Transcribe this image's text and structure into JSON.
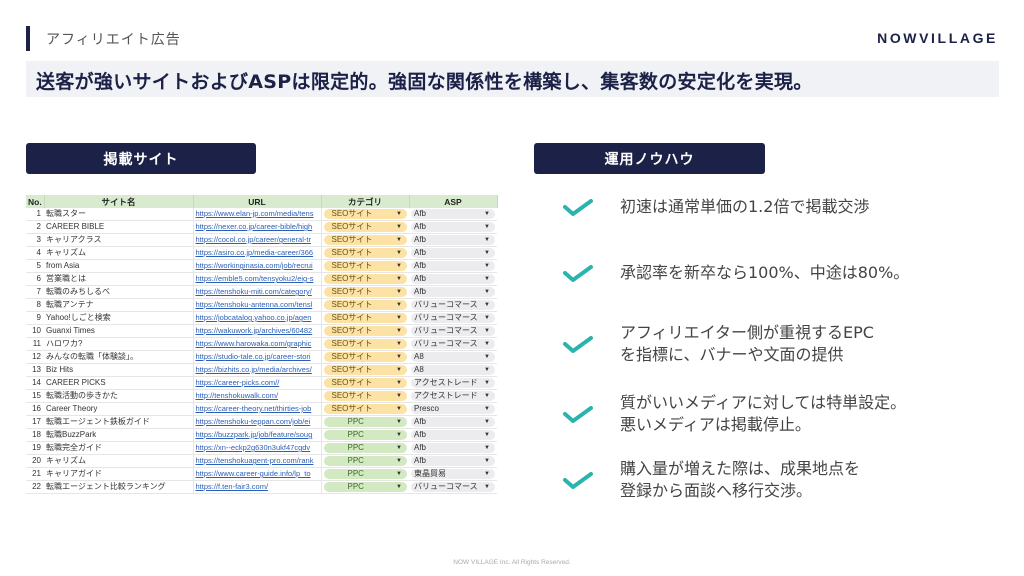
{
  "header": {
    "section_label": "アフィリエイト広告",
    "logo": "NOWVILLAGE",
    "headline": "送客が強いサイトおよびASPは限定的。強固な関係性を構築し、集客数の安定化を実現。"
  },
  "left_panel": {
    "title": "掲載サイト",
    "table": {
      "columns": [
        "No.",
        "サイト名",
        "URL",
        "カテゴリ",
        "ASP"
      ],
      "rows": [
        {
          "no": "1",
          "name": "転職スター",
          "url": "https://www.elan-jp.com/media/tens",
          "category": "SEOサイト",
          "asp": "Afb"
        },
        {
          "no": "2",
          "name": "CAREER BIBLE",
          "url": "https://nexer.co.jp/career-bible/high",
          "category": "SEOサイト",
          "asp": "Afb"
        },
        {
          "no": "3",
          "name": "キャリアクラス",
          "url": "https://cocol.co.jp/career/general-tr",
          "category": "SEOサイト",
          "asp": "Afb"
        },
        {
          "no": "4",
          "name": "キャリズム",
          "url": "https://asiro.co.jp/media-career/366",
          "category": "SEOサイト",
          "asp": "Afb"
        },
        {
          "no": "5",
          "name": "from Asia",
          "url": "https://workinginasia.com/job/recrui",
          "category": "SEOサイト",
          "asp": "Afb"
        },
        {
          "no": "6",
          "name": "営業職とは",
          "url": "https://emble5.com/tensyoku2/eig-s",
          "category": "SEOサイト",
          "asp": "Afb"
        },
        {
          "no": "7",
          "name": "転職のみちしるべ",
          "url": "https://tenshoku-miti.com/category/",
          "category": "SEOサイト",
          "asp": "Afb"
        },
        {
          "no": "8",
          "name": "転職アンテナ",
          "url": "https://tenshoku-antenna.com/tensl",
          "category": "SEOサイト",
          "asp": "バリューコマース"
        },
        {
          "no": "9",
          "name": "Yahoo!しごと検索",
          "url": "https://jobcatalog.yahoo.co.jp/agen",
          "category": "SEOサイト",
          "asp": "バリューコマース"
        },
        {
          "no": "10",
          "name": "Guanxi Times",
          "url": "https://wakuwork.jp/archives/60482",
          "category": "SEOサイト",
          "asp": "バリューコマース"
        },
        {
          "no": "11",
          "name": "ハロワカ?",
          "url": "https://www.harowaka.com/graphic",
          "category": "SEOサイト",
          "asp": "バリューコマース"
        },
        {
          "no": "12",
          "name": "みんなの転職「体験談」。",
          "url": "https://studio-tale.co.jp/career-stori",
          "category": "SEOサイト",
          "asp": "A8"
        },
        {
          "no": "13",
          "name": "Biz Hits",
          "url": "https://bizhits.co.jp/media/archives/",
          "category": "SEOサイト",
          "asp": "A8"
        },
        {
          "no": "14",
          "name": "CAREER PICKS",
          "url": "https://career-picks.com//",
          "category": "SEOサイト",
          "asp": "アクセストレード"
        },
        {
          "no": "15",
          "name": "転職活動の歩きかた",
          "url": "http://tenshokuwalk.com/",
          "category": "SEOサイト",
          "asp": "アクセストレード"
        },
        {
          "no": "16",
          "name": "Career Theory",
          "url": "https://career-theory.net/thirties-job",
          "category": "SEOサイト",
          "asp": "Presco"
        },
        {
          "no": "17",
          "name": "転職エージェント鉄板ガイド",
          "url": "https://tenshoku-teppan.com/job/ei",
          "category": "PPC",
          "asp": "Afb"
        },
        {
          "no": "18",
          "name": "転職BuzzPark",
          "url": "https://buzzpark.jp/job/feature/soug",
          "category": "PPC",
          "asp": "Afb"
        },
        {
          "no": "19",
          "name": "転職完全ガイド",
          "url": "https://xn--eckp2g630n3ukf47cgdv",
          "category": "PPC",
          "asp": "Afb"
        },
        {
          "no": "20",
          "name": "キャリズム",
          "url": "https://tenshokuagent-pro.com/rank",
          "category": "PPC",
          "asp": "Afb"
        },
        {
          "no": "21",
          "name": "キャリアガイド",
          "url": "https://www.career-guide.info/lp_to",
          "category": "PPC",
          "asp": "東晶貿易"
        },
        {
          "no": "22",
          "name": "転職エージェント比較ランキング",
          "url": "https://f.ten-fair3.com/",
          "category": "PPC",
          "asp": "バリューコマース"
        }
      ]
    }
  },
  "right_panel": {
    "title": "運用ノウハウ",
    "icon": "check-icon",
    "accent_color": "#2bb3ad",
    "items": [
      {
        "text": "初速は通常単価の1.2倍で掲載交渉"
      },
      {
        "text": "承認率を新卒なら100%、中途は80%。"
      },
      {
        "text": "アフィリエイター側が重視するEPC\nを指標に、バナーや文面の提供"
      },
      {
        "text": "質がいいメディアに対しては特単設定。\n悪いメディアは掲載停止。"
      },
      {
        "text": "購入量が増えた際は、成果地点を\n登録から面談へ移行交渉。"
      }
    ]
  },
  "footer": {
    "copyright": "NOW VILLAGE Inc. All Rights Reserved."
  }
}
